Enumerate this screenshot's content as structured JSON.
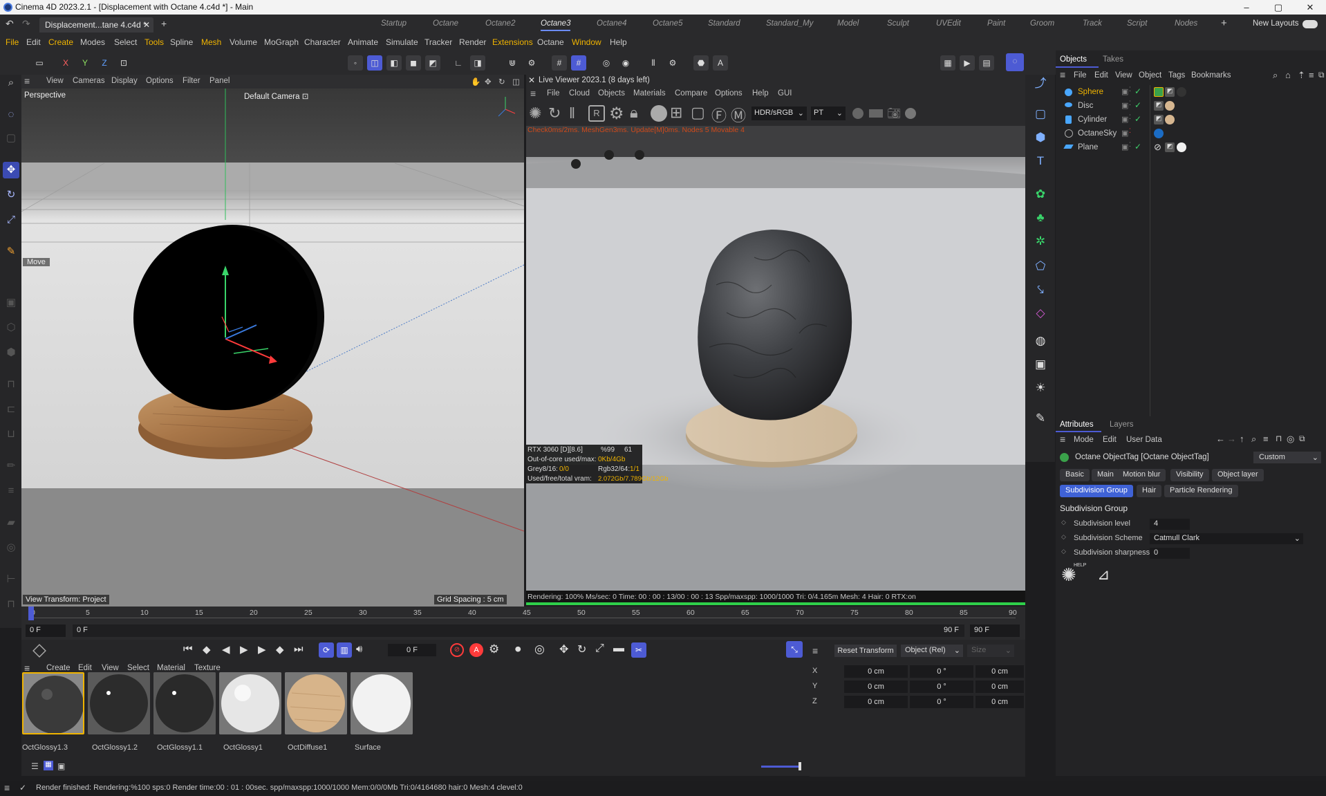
{
  "window": {
    "title": "Cinema 4D 2023.2.1 - [Displacement with Octane 4.c4d *] - Main",
    "minimize": "–",
    "maximize": "▢",
    "close": "✕"
  },
  "doc_tab": {
    "label": "Displacement...tane 4.c4d *",
    "close": "✕",
    "add": "+"
  },
  "layouts": [
    "Startup",
    "Octane",
    "Octane2",
    "Octane3",
    "Octane4",
    "Octane5",
    "Standard",
    "Standard_My",
    "Model",
    "Sculpt",
    "UVEdit",
    "Paint",
    "Groom",
    "Track",
    "Script",
    "Nodes"
  ],
  "active_layout": "Octane3",
  "new_layouts": "New Layouts",
  "menu": [
    "File",
    "Edit",
    "Create",
    "Modes",
    "Select",
    "Tools",
    "Spline",
    "Mesh",
    "Volume",
    "MoGraph",
    "Character",
    "Animate",
    "Simulate",
    "Tracker",
    "Render",
    "Extensions",
    "Octane",
    "Window",
    "Help"
  ],
  "axes": {
    "x": "X",
    "y": "Y",
    "z": "Z"
  },
  "viewport": {
    "menu": [
      "View",
      "Cameras",
      "Display",
      "Options",
      "Filter",
      "Panel"
    ],
    "projection": "Perspective",
    "camera": "Default Camera",
    "camera_icon": "⊡",
    "tool_hint": "Move",
    "view_transform": "View Transform: Project",
    "grid_spacing": "Grid Spacing : 5 cm"
  },
  "live_viewer": {
    "title": "Live Viewer 2023.1 (8 days left)",
    "menu": [
      "File",
      "Cloud",
      "Objects",
      "Materials",
      "Compare",
      "Options",
      "Help",
      "GUI"
    ],
    "color_mode": "HDR/sRGB",
    "kernel": "PT",
    "overlay": "Check0ms/2ms. MeshGen3ms. Update[M]0ms. Nodes 5 Movable 4",
    "gpu": {
      "card": "RTX 3060 [D][8.6]",
      "pct": "%99",
      "temp": "61",
      "outofcore_label": "Out-of-core used/max:",
      "outofcore_value": "0Kb/4Gb",
      "grey_label": "Grey8/16:",
      "grey_value": "0/0",
      "rgb_label": "Rgb32/64:",
      "rgb_value": "1/1",
      "vram_label": "Used/free/total vram:",
      "vram_value": "2.072Gb/7.789Gb/12Gb"
    },
    "status": "Rendering: 100%  Ms/sec: 0    Time: 00 : 00 : 13/00 : 00 : 13   Spp/maxspp: 1000/1000    Tri: 0/4.165m    Mesh: 4  Hair: 0    RTX:on"
  },
  "objects_panel": {
    "tabs": [
      "Objects",
      "Takes"
    ],
    "menu": [
      "File",
      "Edit",
      "View",
      "Object",
      "Tags",
      "Bookmarks"
    ],
    "items": [
      {
        "name": "Sphere",
        "selected": true,
        "icon": "sphere-icon",
        "color": "#f0b400"
      },
      {
        "name": "Disc",
        "selected": false,
        "icon": "disc-icon",
        "color": "#c8c8c8"
      },
      {
        "name": "Cylinder",
        "selected": false,
        "icon": "cylinder-icon",
        "color": "#c8c8c8"
      },
      {
        "name": "OctaneSky",
        "selected": false,
        "icon": "octanesky-icon",
        "color": "#c8c8c8"
      },
      {
        "name": "Plane",
        "selected": false,
        "icon": "plane-icon",
        "color": "#c8c8c8"
      }
    ]
  },
  "attributes": {
    "tabs": [
      "Attributes",
      "Layers"
    ],
    "menu": [
      "Mode",
      "Edit",
      "User Data"
    ],
    "object_title": "Octane ObjectTag [Octane ObjectTag]",
    "preset": "Custom",
    "subtabs_row1": [
      "Basic",
      "Main",
      "Motion blur",
      "Visibility",
      "Object layer"
    ],
    "subtabs_row2": [
      "Subdivision Group",
      "Hair",
      "Particle Rendering"
    ],
    "section": "Subdivision Group",
    "fields": [
      {
        "label": "Subdivision level",
        "value": "4"
      },
      {
        "label": "Subdivision Scheme",
        "value": "Catmull Clark"
      },
      {
        "label": "Subdivision sharpness",
        "value": "0"
      }
    ],
    "help_label": "HELP"
  },
  "timeline": {
    "ticks": [
      "0",
      "5",
      "10",
      "15",
      "20",
      "25",
      "30",
      "35",
      "40",
      "45",
      "50",
      "55",
      "60",
      "65",
      "70",
      "75",
      "80",
      "85",
      "90"
    ],
    "start_frame": "0 F",
    "start_frame2": "0 F",
    "end_frame": "90 F",
    "end_frame2": "90 F",
    "current_frame": "0 F"
  },
  "materials": {
    "menu": [
      "Create",
      "Edit",
      "View",
      "Select",
      "Material",
      "Texture"
    ],
    "items": [
      {
        "name": "OctGlossy1.3",
        "color": "#3a3a3a"
      },
      {
        "name": "OctGlossy1.2",
        "color": "#2c2c2c"
      },
      {
        "name": "OctGlossy1.1",
        "color": "#2a2a2a"
      },
      {
        "name": "OctGlossy1",
        "color": "#e6e6e6"
      },
      {
        "name": "OctDiffuse1",
        "color": "#d7b48a"
      },
      {
        "name": "Surface",
        "color": "#f2f2f2"
      }
    ]
  },
  "coords": {
    "reset": "Reset Transform",
    "mode": "Object (Rel)",
    "size": "Size",
    "rows": [
      {
        "axis": "X",
        "pos": "0 cm",
        "rot": "0 °",
        "size": "0 cm"
      },
      {
        "axis": "Y",
        "pos": "0 cm",
        "rot": "0 °",
        "size": "0 cm"
      },
      {
        "axis": "Z",
        "pos": "0 cm",
        "rot": "0 °",
        "size": "0 cm"
      }
    ]
  },
  "status_bar": "Render finished: Rendering:%100 sps:0 Render time:00 : 01 : 00sec. spp/maxspp:1000/1000 Mem:0/0/0Mb Tri:0/4164680 hair:0 Mesh:4 clevel:0",
  "colors": {
    "accent": "#4d5bd4",
    "highlight": "#f0b400",
    "progress": "#2fd04a"
  }
}
